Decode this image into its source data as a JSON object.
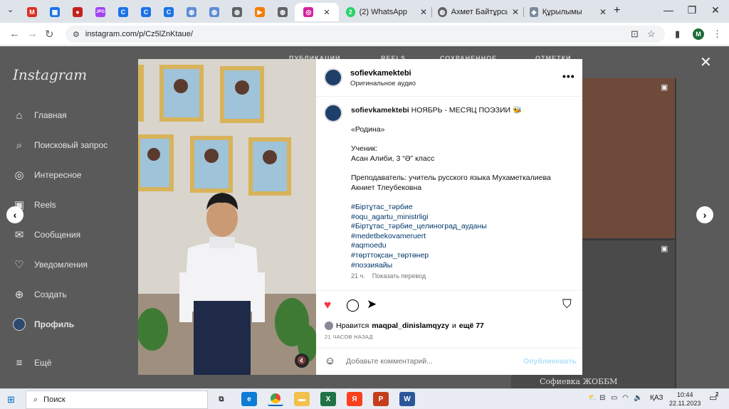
{
  "browser": {
    "tabs": [
      {
        "fav": "gmail",
        "color": "#d93025",
        "glyph": "M"
      },
      {
        "fav": "grid-app",
        "color": "#1a73e8",
        "glyph": "▦"
      },
      {
        "fav": "app-red",
        "color": "#c5221f",
        "glyph": "●"
      },
      {
        "fav": "jpg-app",
        "color": "#a142f4",
        "glyph": "JPG"
      },
      {
        "fav": "c-app",
        "color": "#1a73e8",
        "glyph": "C"
      },
      {
        "fav": "c-app",
        "color": "#1a73e8",
        "glyph": "C"
      },
      {
        "fav": "c-app",
        "color": "#1a73e8",
        "glyph": "C"
      },
      {
        "fav": "globe",
        "color": "#5f8dd3",
        "glyph": "◍"
      },
      {
        "fav": "globe",
        "color": "#5f8dd3",
        "glyph": "◍"
      },
      {
        "fav": "globe",
        "color": "#5f6368",
        "glyph": "◍"
      },
      {
        "fav": "play-app",
        "color": "#f57c00",
        "glyph": "▶"
      },
      {
        "fav": "globe",
        "color": "#5f6368",
        "glyph": "◍"
      },
      {
        "fav": "instagram",
        "color": "#d6249f",
        "glyph": "◎"
      }
    ],
    "tab_whatsapp": "(2) WhatsApp",
    "tab_akhmet": "Ахмет Байтұрсын",
    "tab_structure": "Құрылымы",
    "url": "instagram.com/p/Cz5lZnKtaue/",
    "profile_initial": "M"
  },
  "sidebar": {
    "logo": "Instagram",
    "items": [
      {
        "label": "Главная",
        "icon": "⌂"
      },
      {
        "label": "Поисковый запрос",
        "icon": "⌕"
      },
      {
        "label": "Интересное",
        "icon": "◎"
      },
      {
        "label": "Reels",
        "icon": "▣"
      },
      {
        "label": "Сообщения",
        "icon": "✉"
      },
      {
        "label": "Уведомления",
        "icon": "♡"
      },
      {
        "label": "Создать",
        "icon": "⊕"
      },
      {
        "label": "Профиль",
        "icon": ""
      },
      {
        "label": "Ещё",
        "icon": "≡"
      }
    ]
  },
  "topnav": [
    "ПУБЛИКАЦИИ",
    "REELS",
    "СОХРАНЕННОЕ",
    "ОТМЕТКИ"
  ],
  "post": {
    "username": "sofievkamektebi",
    "audio": "Оригинальное аудио",
    "caption_user": "sofievkamektebi",
    "caption_first": "НОЯБРЬ - МЕСЯЦ ПОЭЗИИ",
    "lines": [
      "«Родина»",
      "",
      "Ученик:",
      "Асан Алиби, 3 “Ә” класс",
      "",
      "Преподаватель: учитель русского языка Мухаметкалиева",
      "Акниет Тлеубековна"
    ],
    "hashtags": [
      "#Біртұтас_тәрбие",
      "#oqu_agartu_ministrligi",
      "#Біртұтас_тәрбие_целиноград_ауданы",
      "#medetbekovameruert",
      "#aqmoedu",
      "#төрттоқсан_төртөнер",
      "#поэзияайы"
    ],
    "age": "21 ч.",
    "translate": "Показать перевод",
    "likes_prefix": "Нравится",
    "likes_user": "maqpal_dinislamqyzy",
    "likes_and": "и",
    "likes_more": "ещё 77",
    "timestamp": "21 ЧАСОВ НАЗАД",
    "comment_placeholder": "Добавьте комментарий...",
    "publish": "Опубликовать",
    "grid_caption": "Софиевка ЖОББМ"
  },
  "taskbar": {
    "search": "Поиск",
    "lang": "ҚАЗ",
    "time": "10:44",
    "date": "22.11.2023",
    "notif": "2"
  },
  "colors": {
    "like": "#ff3040",
    "link": "#00376b",
    "accent": "#0095f6"
  }
}
